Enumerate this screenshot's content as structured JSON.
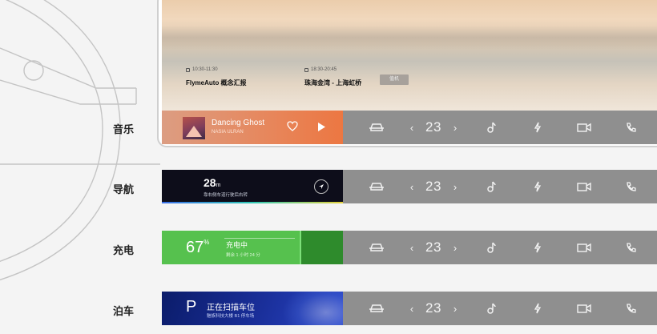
{
  "screen": {
    "events": [
      {
        "time": "10:30-11:30",
        "name": "FlymeAuto 概念汇报"
      },
      {
        "time": "18:30-20:45",
        "name": "珠海金湾 - 上海虹桥"
      }
    ],
    "tag": "值机"
  },
  "rows": [
    {
      "label": "音乐"
    },
    {
      "label": "导航"
    },
    {
      "label": "充电"
    },
    {
      "label": "泊车"
    }
  ],
  "music": {
    "title": "Dancing Ghost",
    "artist": "NASIA ULRAN"
  },
  "nav": {
    "distance": "28",
    "unit": "m",
    "instruction": "靠右侧车道行驶后右转"
  },
  "charge": {
    "percent": "67",
    "unit": "%",
    "state": "充电中",
    "sub": "剩余 1 小时 24 分"
  },
  "park": {
    "letter": "P",
    "state": "正在扫描车位",
    "sub": "魅族科技大楼 B1 停车场"
  },
  "bar": {
    "temperature": "23",
    "left_arrow": "‹",
    "right_arrow": "›"
  },
  "icons": [
    "car-icon",
    "music-note-icon",
    "lightning-icon",
    "video-camera-icon",
    "phone-icon"
  ],
  "colors": {
    "bar": "#8f8f8f",
    "music": "#e7865b",
    "nav": "#0d0d1a",
    "charge": "#56c14e",
    "park": "#1a2f9a"
  }
}
